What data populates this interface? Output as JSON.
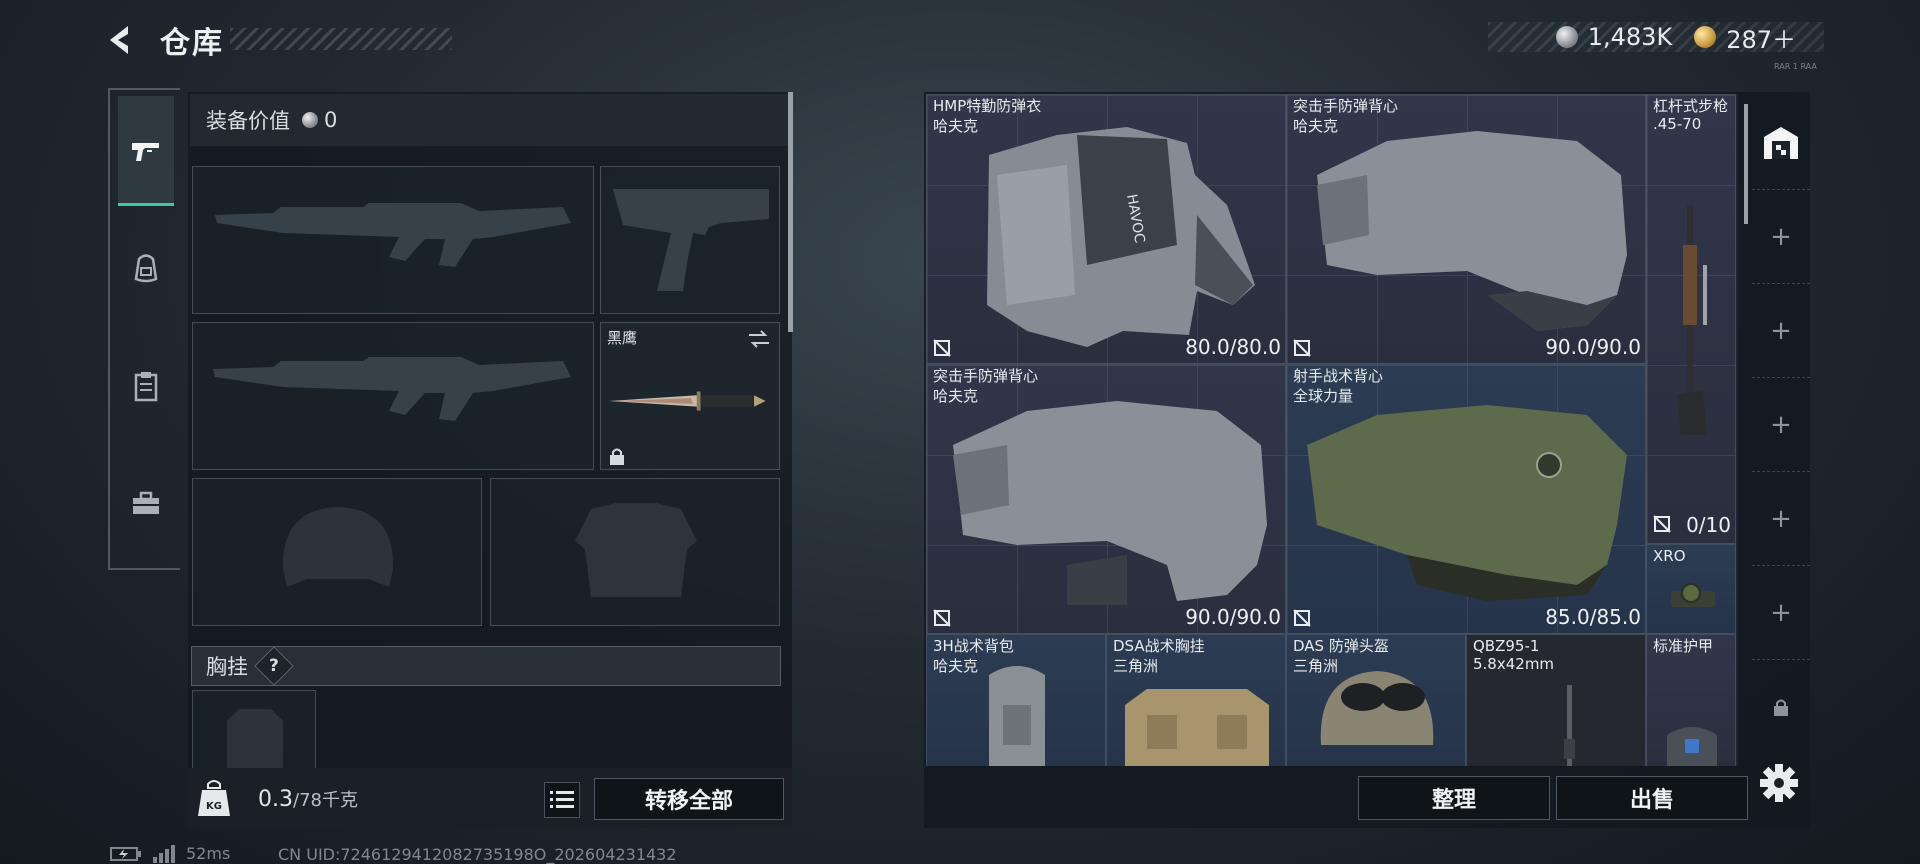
{
  "header": {
    "title": "仓库",
    "back_icon": "back-arrow-icon",
    "currency": [
      {
        "icon": "silver-coin-icon",
        "value": "1,483K"
      },
      {
        "icon": "gold-coin-icon",
        "value": "287＋"
      }
    ],
    "tiny_label": "RAR 1 RAA"
  },
  "left_nav": {
    "items": [
      {
        "name": "weapon-tab",
        "icon": "pistol-icon",
        "active": true
      },
      {
        "name": "backpack-tab",
        "icon": "backpack-icon",
        "active": false
      },
      {
        "name": "clipboard-tab",
        "icon": "clipboard-icon",
        "active": false
      },
      {
        "name": "toolbox-tab",
        "icon": "toolbox-icon",
        "active": false
      }
    ]
  },
  "equipment": {
    "value_label": "装备价值",
    "value": "0",
    "knife_label": "黑鹰",
    "chest_label": "胸挂",
    "chest_help": "?"
  },
  "footer": {
    "weight": "0.3",
    "weight_max": "/78千克",
    "kg_icon_text": "KG",
    "transfer_all": "转移全部"
  },
  "status": {
    "ping": "52ms",
    "uid": "CN UID:7246129412082735198O_202604231432"
  },
  "stash": {
    "items": [
      {
        "name": "HMP特勤防弹衣",
        "sub": "哈夫克",
        "durability": "80.0/80.0"
      },
      {
        "name": "突击手防弹背心",
        "sub": "哈夫克",
        "durability": "90.0/90.0"
      },
      {
        "name": "杠杆式步枪",
        "sub": ".45-70",
        "durability": "0/10"
      },
      {
        "name": "突击手防弹背心",
        "sub": "哈夫克",
        "durability": "90.0/90.0"
      },
      {
        "name": "射手战术背心",
        "sub": "全球力量",
        "durability": "85.0/85.0"
      },
      {
        "name": "XRO",
        "sub": "",
        "durability": ""
      },
      {
        "name": "3H战术背包",
        "sub": "哈夫克",
        "durability": ""
      },
      {
        "name": "DSA战术胸挂",
        "sub": "三角洲",
        "durability": ""
      },
      {
        "name": "DAS 防弹头盔",
        "sub": "三角洲",
        "durability": ""
      },
      {
        "name": "QBZ95-1",
        "sub": "5.8x42mm",
        "durability": ""
      },
      {
        "name": "标准护甲",
        "sub": "",
        "durability": ""
      }
    ]
  },
  "right_rail": {
    "add_symbol": "+"
  },
  "actions": {
    "sort": "整理",
    "sell": "出售"
  },
  "colors": {
    "accent": "#3fc8a8",
    "panel": "#12181e",
    "cell": "#2e3242"
  }
}
